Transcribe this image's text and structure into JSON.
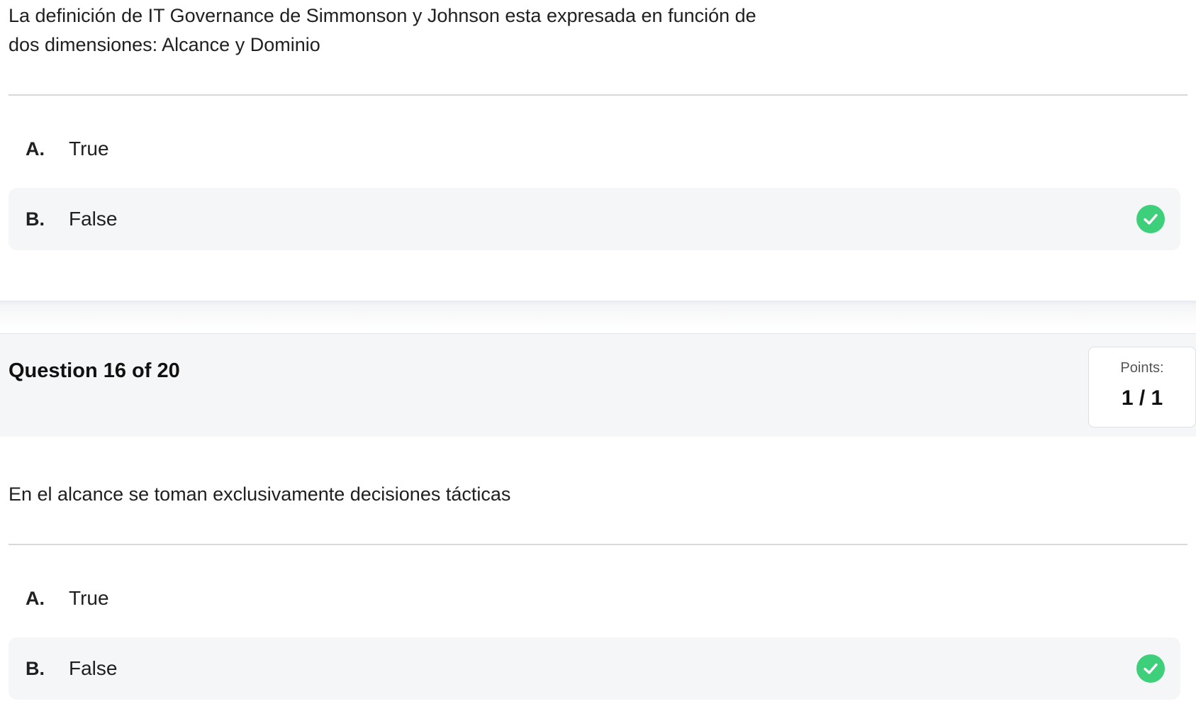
{
  "previous_question": {
    "text": "La definición de IT Governance de Simmonson y Johnson esta expresada en función de\ndos dimensiones: Alcance y Dominio",
    "options": [
      {
        "letter": "A.",
        "label": "True",
        "selected": false
      },
      {
        "letter": "B.",
        "label": "False",
        "selected": true,
        "correct_icon": "check-circle-icon"
      }
    ]
  },
  "current_question": {
    "title": "Question 16 of 20",
    "points_label": "Points:",
    "points_value": "1 / 1",
    "text": "En el alcance se toman exclusivamente decisiones tácticas",
    "options": [
      {
        "letter": "A.",
        "label": "True",
        "selected": false
      },
      {
        "letter": "B.",
        "label": "False",
        "selected": true,
        "correct_icon": "check-circle-icon"
      }
    ]
  },
  "colors": {
    "correct": "#3ecf7a",
    "selected_bg": "#f5f6f8",
    "header_bg": "#f5f6f8"
  }
}
